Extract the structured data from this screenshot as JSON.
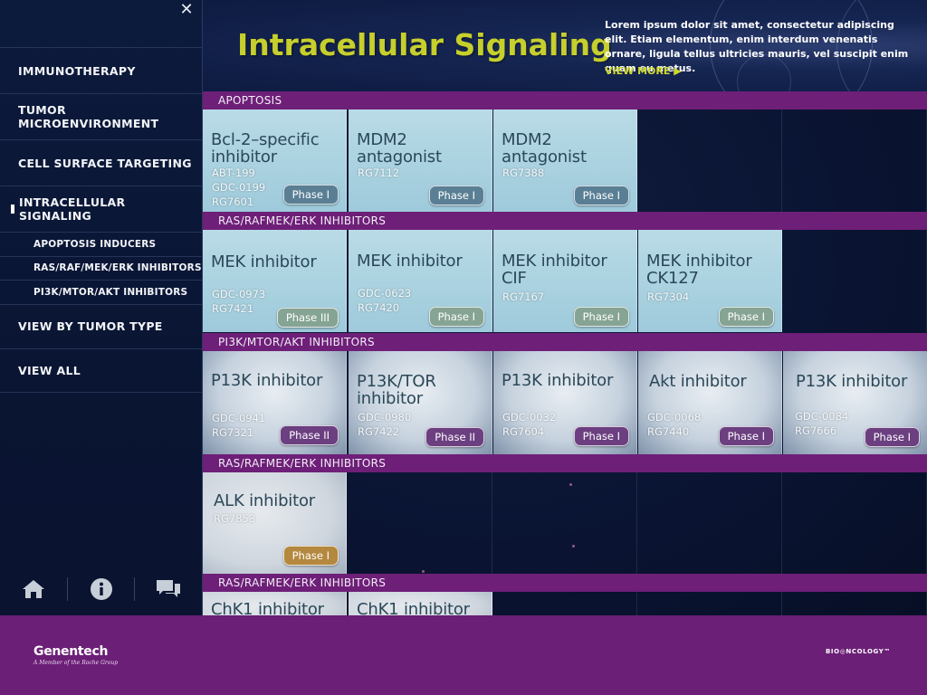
{
  "sidebar": {
    "close_label": "✕",
    "nav": [
      {
        "label": "IMMUNOTHERAPY"
      },
      {
        "label": "TUMOR MICROENVIRONMENT"
      },
      {
        "label": "CELL SURFACE TARGETING"
      },
      {
        "label": "INTRACELLULAR SIGNALING",
        "active": true
      }
    ],
    "subnav": [
      {
        "label": "APOPTOSIS INDUCERS"
      },
      {
        "label": "RAS/RAF/MEK/ERK INHIBITORS"
      },
      {
        "label": "PI3K/MTOR/AKT INHIBITORS"
      }
    ],
    "nav_after": [
      {
        "label": "VIEW BY TUMOR TYPE"
      },
      {
        "label": "VIEW ALL"
      }
    ],
    "bottom_icons": [
      "home-icon",
      "info-icon",
      "chat-icon"
    ]
  },
  "header": {
    "title": "Intracellular Signaling",
    "description": "Lorem ipsum dolor sit amet, consectetur adipiscing elit. Etiam elementum, enim interdum venenatis ornare, ligula tellus ultricies mauris, vel suscipit enim quam eu metus.",
    "view_more": "VIEW MORE ▶"
  },
  "sections": [
    {
      "label": "APOPTOSIS",
      "cards": [
        {
          "name": "Bcl-2–specific inhibitor",
          "codes": [
            "ABT-199",
            "GDC-0199",
            "RG7601"
          ],
          "phase": "Phase I"
        },
        {
          "name": "MDM2 antagonist",
          "codes": [
            "RG7112"
          ],
          "phase": "Phase I"
        },
        {
          "name": "MDM2 antagonist",
          "codes": [
            "RG7388"
          ],
          "phase": "Phase I"
        }
      ]
    },
    {
      "label": "RAS/RAFMEK/ERK INHIBITORS",
      "cards": [
        {
          "name": "MEK inhibitor",
          "codes": [
            "GDC-0973",
            "RG7421"
          ],
          "phase": "Phase III"
        },
        {
          "name": "MEK inhibitor",
          "codes": [
            "GDC-0623",
            "RG7420"
          ],
          "phase": "Phase I"
        },
        {
          "name": "MEK inhibitor CIF",
          "codes": [
            "RG7167"
          ],
          "phase": "Phase I"
        },
        {
          "name": "MEK inhibitor CK127",
          "codes": [
            "RG7304"
          ],
          "phase": "Phase I"
        }
      ]
    },
    {
      "label": "PI3K/MTOR/AKT INHIBITORS",
      "cards": [
        {
          "name": "P13K inhibitor",
          "codes": [
            "GDC-0941",
            "RG7321"
          ],
          "phase": "Phase II"
        },
        {
          "name": "P13K/TOR inhibitor",
          "codes": [
            "GDC-0980",
            "RG7422"
          ],
          "phase": "Phase II"
        },
        {
          "name": "P13K inhibitor",
          "codes": [
            "GDC-0032",
            "RG7604"
          ],
          "phase": "Phase I"
        },
        {
          "name": "Akt inhibitor",
          "codes": [
            "GDC-0068",
            "RG7440"
          ],
          "phase": "Phase I"
        },
        {
          "name": "P13K inhibitor",
          "codes": [
            "GDC-0084",
            "RG7666"
          ],
          "phase": "Phase I"
        }
      ]
    },
    {
      "label": "RAS/RAFMEK/ERK INHIBITORS",
      "cards": [
        {
          "name": "ALK inhibitor",
          "codes": [
            "RG7853"
          ],
          "phase": "Phase I"
        }
      ]
    },
    {
      "label": "RAS/RAFMEK/ERK INHIBITORS",
      "cards": [
        {
          "name": "ChK1 inhibitor",
          "codes": [],
          "phase": ""
        },
        {
          "name": "ChK1 inhibitor",
          "codes": [],
          "phase": ""
        }
      ]
    }
  ],
  "footer": {
    "brand": "Genentech",
    "brand_sub": "A Member of the Roche Group",
    "onco": "BIO◎NCOLOGY™"
  },
  "colors": {
    "section_bar": "#6e1f78",
    "title": "#c6cf2c",
    "footer": "#6b1f76",
    "phase_steel": "#5a7f95",
    "phase_sage": "#86a493",
    "phase_plum": "#6b3f80",
    "phase_gold": "#b4883e"
  }
}
